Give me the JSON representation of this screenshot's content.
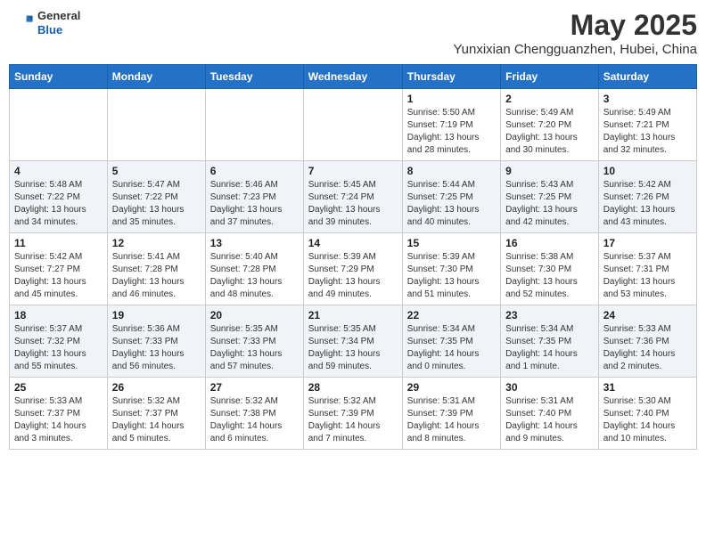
{
  "header": {
    "logo_general": "General",
    "logo_blue": "Blue",
    "month_title": "May 2025",
    "subtitle": "Yunxixian Chengguanzhen, Hubei, China"
  },
  "columns": [
    "Sunday",
    "Monday",
    "Tuesday",
    "Wednesday",
    "Thursday",
    "Friday",
    "Saturday"
  ],
  "weeks": [
    [
      {
        "day": "",
        "info": ""
      },
      {
        "day": "",
        "info": ""
      },
      {
        "day": "",
        "info": ""
      },
      {
        "day": "",
        "info": ""
      },
      {
        "day": "1",
        "info": "Sunrise: 5:50 AM\nSunset: 7:19 PM\nDaylight: 13 hours\nand 28 minutes."
      },
      {
        "day": "2",
        "info": "Sunrise: 5:49 AM\nSunset: 7:20 PM\nDaylight: 13 hours\nand 30 minutes."
      },
      {
        "day": "3",
        "info": "Sunrise: 5:49 AM\nSunset: 7:21 PM\nDaylight: 13 hours\nand 32 minutes."
      }
    ],
    [
      {
        "day": "4",
        "info": "Sunrise: 5:48 AM\nSunset: 7:22 PM\nDaylight: 13 hours\nand 34 minutes."
      },
      {
        "day": "5",
        "info": "Sunrise: 5:47 AM\nSunset: 7:22 PM\nDaylight: 13 hours\nand 35 minutes."
      },
      {
        "day": "6",
        "info": "Sunrise: 5:46 AM\nSunset: 7:23 PM\nDaylight: 13 hours\nand 37 minutes."
      },
      {
        "day": "7",
        "info": "Sunrise: 5:45 AM\nSunset: 7:24 PM\nDaylight: 13 hours\nand 39 minutes."
      },
      {
        "day": "8",
        "info": "Sunrise: 5:44 AM\nSunset: 7:25 PM\nDaylight: 13 hours\nand 40 minutes."
      },
      {
        "day": "9",
        "info": "Sunrise: 5:43 AM\nSunset: 7:25 PM\nDaylight: 13 hours\nand 42 minutes."
      },
      {
        "day": "10",
        "info": "Sunrise: 5:42 AM\nSunset: 7:26 PM\nDaylight: 13 hours\nand 43 minutes."
      }
    ],
    [
      {
        "day": "11",
        "info": "Sunrise: 5:42 AM\nSunset: 7:27 PM\nDaylight: 13 hours\nand 45 minutes."
      },
      {
        "day": "12",
        "info": "Sunrise: 5:41 AM\nSunset: 7:28 PM\nDaylight: 13 hours\nand 46 minutes."
      },
      {
        "day": "13",
        "info": "Sunrise: 5:40 AM\nSunset: 7:28 PM\nDaylight: 13 hours\nand 48 minutes."
      },
      {
        "day": "14",
        "info": "Sunrise: 5:39 AM\nSunset: 7:29 PM\nDaylight: 13 hours\nand 49 minutes."
      },
      {
        "day": "15",
        "info": "Sunrise: 5:39 AM\nSunset: 7:30 PM\nDaylight: 13 hours\nand 51 minutes."
      },
      {
        "day": "16",
        "info": "Sunrise: 5:38 AM\nSunset: 7:30 PM\nDaylight: 13 hours\nand 52 minutes."
      },
      {
        "day": "17",
        "info": "Sunrise: 5:37 AM\nSunset: 7:31 PM\nDaylight: 13 hours\nand 53 minutes."
      }
    ],
    [
      {
        "day": "18",
        "info": "Sunrise: 5:37 AM\nSunset: 7:32 PM\nDaylight: 13 hours\nand 55 minutes."
      },
      {
        "day": "19",
        "info": "Sunrise: 5:36 AM\nSunset: 7:33 PM\nDaylight: 13 hours\nand 56 minutes."
      },
      {
        "day": "20",
        "info": "Sunrise: 5:35 AM\nSunset: 7:33 PM\nDaylight: 13 hours\nand 57 minutes."
      },
      {
        "day": "21",
        "info": "Sunrise: 5:35 AM\nSunset: 7:34 PM\nDaylight: 13 hours\nand 59 minutes."
      },
      {
        "day": "22",
        "info": "Sunrise: 5:34 AM\nSunset: 7:35 PM\nDaylight: 14 hours\nand 0 minutes."
      },
      {
        "day": "23",
        "info": "Sunrise: 5:34 AM\nSunset: 7:35 PM\nDaylight: 14 hours\nand 1 minute."
      },
      {
        "day": "24",
        "info": "Sunrise: 5:33 AM\nSunset: 7:36 PM\nDaylight: 14 hours\nand 2 minutes."
      }
    ],
    [
      {
        "day": "25",
        "info": "Sunrise: 5:33 AM\nSunset: 7:37 PM\nDaylight: 14 hours\nand 3 minutes."
      },
      {
        "day": "26",
        "info": "Sunrise: 5:32 AM\nSunset: 7:37 PM\nDaylight: 14 hours\nand 5 minutes."
      },
      {
        "day": "27",
        "info": "Sunrise: 5:32 AM\nSunset: 7:38 PM\nDaylight: 14 hours\nand 6 minutes."
      },
      {
        "day": "28",
        "info": "Sunrise: 5:32 AM\nSunset: 7:39 PM\nDaylight: 14 hours\nand 7 minutes."
      },
      {
        "day": "29",
        "info": "Sunrise: 5:31 AM\nSunset: 7:39 PM\nDaylight: 14 hours\nand 8 minutes."
      },
      {
        "day": "30",
        "info": "Sunrise: 5:31 AM\nSunset: 7:40 PM\nDaylight: 14 hours\nand 9 minutes."
      },
      {
        "day": "31",
        "info": "Sunrise: 5:30 AM\nSunset: 7:40 PM\nDaylight: 14 hours\nand 10 minutes."
      }
    ]
  ]
}
